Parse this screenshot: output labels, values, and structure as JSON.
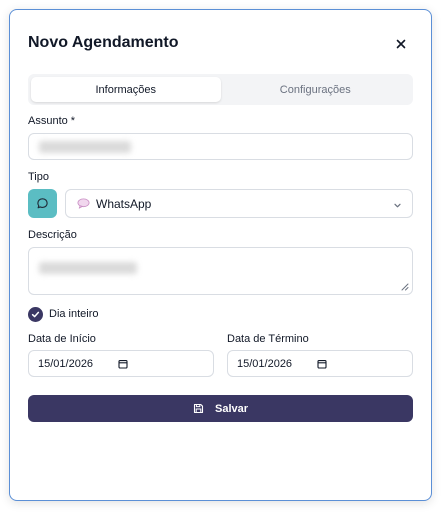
{
  "dialog": {
    "title": "Novo Agendamento",
    "close_label": "×"
  },
  "tabs": [
    {
      "label": "Informações",
      "active": true
    },
    {
      "label": "Configurações",
      "active": false
    }
  ],
  "form": {
    "subject_label": "Assunto *",
    "type_label": "Tipo",
    "type_selected": "WhatsApp",
    "type_icon": "chat-bubble-icon",
    "description_label": "Descrição",
    "all_day_label": "Dia inteiro",
    "all_day_checked": true,
    "start_date_label": "Data de Início",
    "start_date_value": "15/01/2026",
    "end_date_label": "Data de Término",
    "end_date_value": "15/01/2026",
    "save_label": "Salvar"
  },
  "colors": {
    "primary": "#3a3763",
    "type_accent": "#5bbdc3",
    "dialog_border": "#5b8fd6"
  }
}
